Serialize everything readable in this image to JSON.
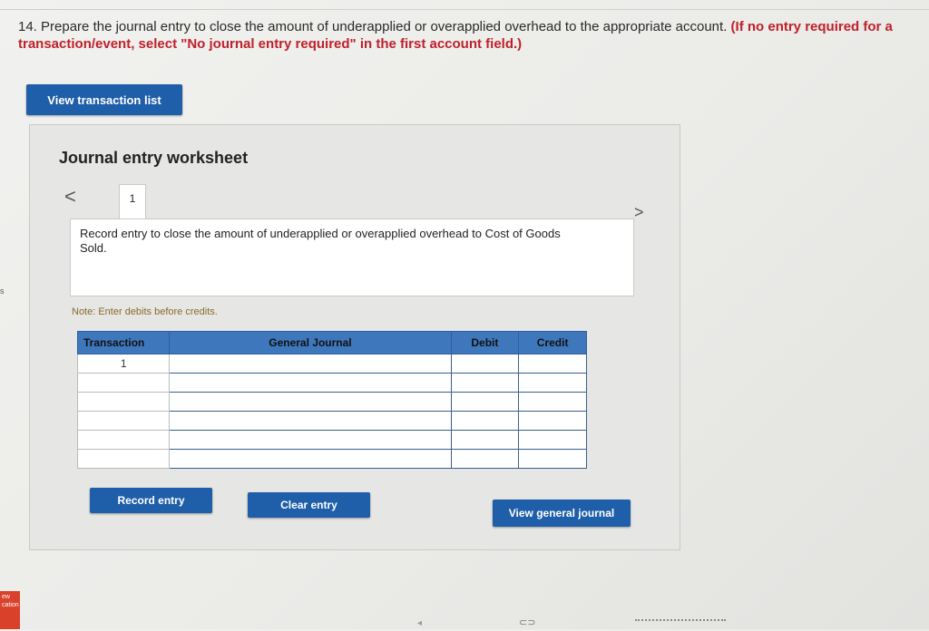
{
  "question": {
    "number": "14.",
    "text": "Prepare the journal entry to close the amount of underapplied or overapplied overhead to the appropriate account.",
    "instruction": "(If no entry is required for a transaction/event, select \"No journal entry required\" in the first account field.)",
    "instruction_display": "(If no entry required for a transaction/event, select \"No journal entry required\" in the first account field.)"
  },
  "buttons": {
    "view_transaction_list": "View transaction list",
    "record_entry": "Record entry",
    "clear_entry": "Clear entry",
    "view_general_journal": "View general journal"
  },
  "worksheet": {
    "title": "Journal entry worksheet",
    "prev_icon": "<",
    "next_icon": ">",
    "tab_label": "1",
    "description": "Record entry to close the amount of underapplied or overapplied overhead to Cost of Goods Sold.",
    "note": "Note: Enter debits before credits."
  },
  "table": {
    "headers": [
      "Transaction",
      "General Journal",
      "Debit",
      "Credit"
    ],
    "rows": [
      {
        "transaction": "1",
        "account": "",
        "debit": "",
        "credit": ""
      },
      {
        "transaction": "",
        "account": "",
        "debit": "",
        "credit": ""
      },
      {
        "transaction": "",
        "account": "",
        "debit": "",
        "credit": ""
      },
      {
        "transaction": "",
        "account": "",
        "debit": "",
        "credit": ""
      },
      {
        "transaction": "",
        "account": "",
        "debit": "",
        "credit": ""
      },
      {
        "transaction": "",
        "account": "",
        "debit": "",
        "credit": ""
      }
    ]
  },
  "side": {
    "left_mark": "s",
    "tab_text": "ew\ncation"
  },
  "colors": {
    "button_blue": "#1f5ea8",
    "header_blue": "#3f77bd",
    "instruction_red": "#c0202a"
  }
}
